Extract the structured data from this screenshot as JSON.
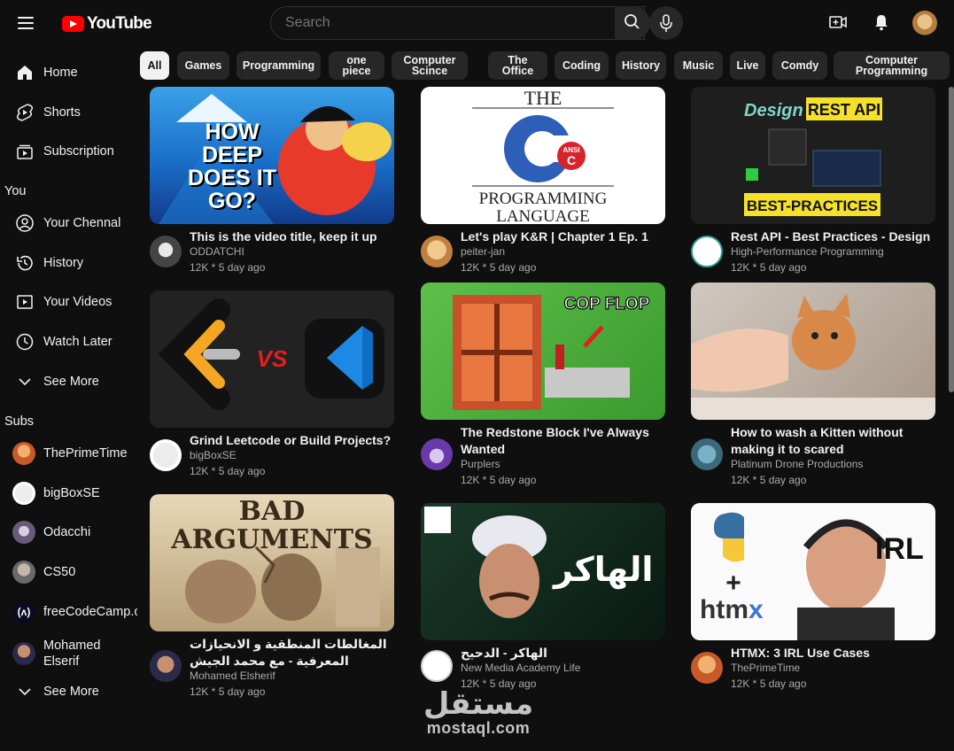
{
  "header": {
    "logo_text": "YouTube",
    "search_placeholder": "Search"
  },
  "sidebar": {
    "main": [
      {
        "label": "Home",
        "icon": "home-icon"
      },
      {
        "label": "Shorts",
        "icon": "shorts-icon"
      },
      {
        "label": "Subscription",
        "icon": "subscriptions-icon"
      }
    ],
    "you_heading": "You",
    "you": [
      {
        "label": "Your Chennal",
        "icon": "channel-icon"
      },
      {
        "label": "History",
        "icon": "history-icon"
      },
      {
        "label": "Your Videos",
        "icon": "your-videos-icon"
      },
      {
        "label": "Watch Later",
        "icon": "watch-later-icon"
      },
      {
        "label": "See More",
        "icon": "chevron-down-icon"
      }
    ],
    "subs_heading": "Subs",
    "subs": [
      {
        "label": "ThePrimeTime",
        "color": "#c85a2a"
      },
      {
        "label": "bigBoxSE",
        "color": "#e8e8e8"
      },
      {
        "label": "Odacchi",
        "color": "#6a5a7a"
      },
      {
        "label": "CS50",
        "color": "#8a8a8a"
      },
      {
        "label": "freeCodeCamp.org",
        "color": "#0a0a23"
      },
      {
        "label": "Mohamed Elserif",
        "color": "#3a3a5a"
      },
      {
        "label": "See More",
        "icon": "chevron-down-icon"
      }
    ]
  },
  "chips": [
    "All",
    "Games",
    "Programming",
    "one piece",
    "Computer Scince",
    "The Office",
    "Coding",
    "History",
    "Music",
    "Live",
    "Comdy",
    "Computer Programming"
  ],
  "videos": [
    {
      "title": "This is the video title, keep it up",
      "channel": "ODDATCHI",
      "stats": "12K * 5 day ago",
      "thumb_text": "HOW DEEP DOES IT GO?"
    },
    {
      "title": "Let's play K&R | Chapter 1 Ep. 1",
      "channel": "peiter-jan",
      "stats": "12K * 5 day ago",
      "thumb_text": "THE C PROGRAMMING LANGUAGE"
    },
    {
      "title": "Rest API - Best Practices - Design",
      "channel": "High-Performance Programming",
      "stats": "12K * 5 day ago",
      "thumb_text": "Design REST API BEST-PRACTICES"
    },
    {
      "title": "Grind Leetcode or Build Projects?",
      "channel": "bigBoxSE",
      "stats": "12K * 5 day ago",
      "thumb_text": "VS"
    },
    {
      "title": "The Redstone Block I've Always Wanted",
      "channel": "Purplers",
      "stats": "12K * 5 day ago",
      "thumb_text": "COP FLOP"
    },
    {
      "title": "How to wash a Kitten without making it to scared",
      "channel": "Platinum Drone Productions",
      "stats": "12K * 5 day ago",
      "thumb_text": ""
    },
    {
      "title": "المغالطات المنطقية و الانحيازات المعرفية - مع محمد الجيش",
      "channel": "Mohamed Elsherif",
      "stats": "12K * 5 day ago",
      "thumb_text": "BAD ARGUMENTS"
    },
    {
      "title": "الهاكر - الدحيح",
      "channel": "New Media Academy Life",
      "stats": "12K * 5 day ago",
      "thumb_text": "الهاكر"
    },
    {
      "title": "HTMX: 3 IRL Use Cases",
      "channel": "ThePrimeTime",
      "stats": "12K * 5 day ago",
      "thumb_text": "IRL htmx"
    }
  ],
  "watermark": {
    "main": "مستقل",
    "sub": "mostaql.com"
  }
}
